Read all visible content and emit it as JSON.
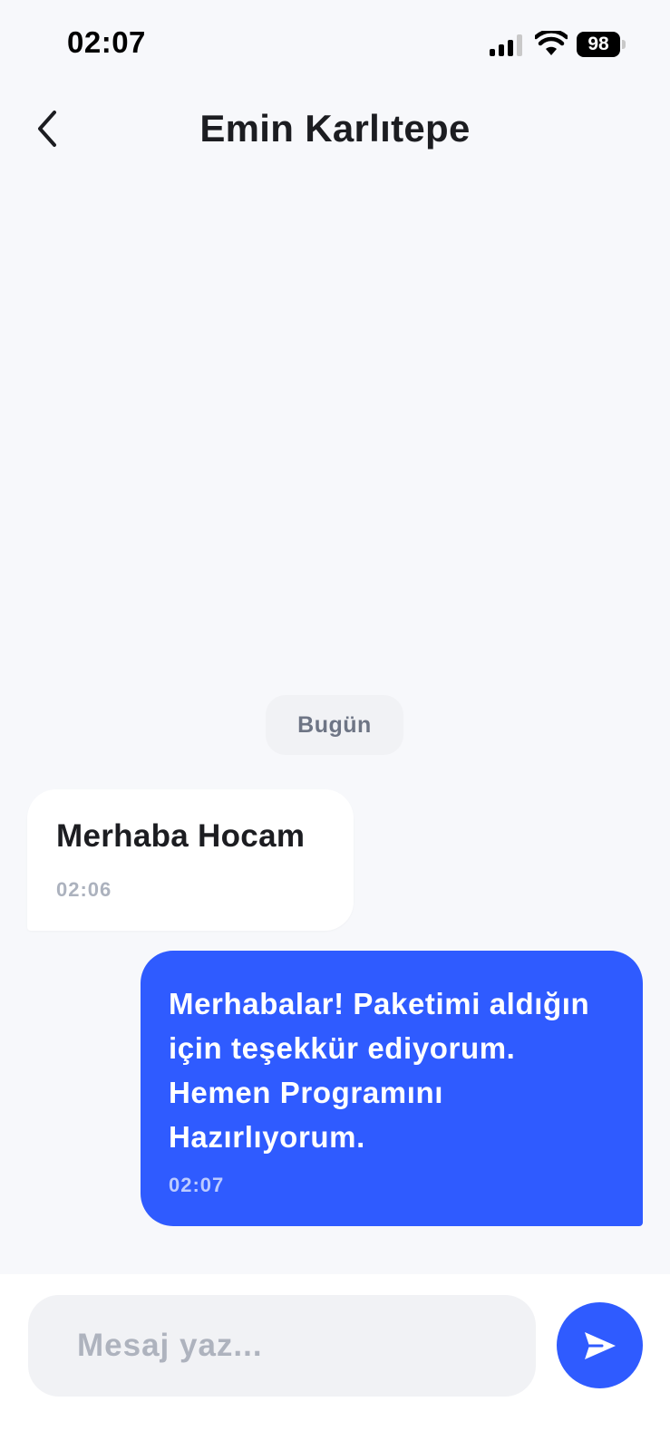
{
  "status_bar": {
    "time": "02:07",
    "battery": "98",
    "icons": [
      "signal-icon",
      "wifi-icon",
      "battery-icon"
    ]
  },
  "header": {
    "title": "Emin Karlıtepe",
    "back_icon": "chevron-left-icon"
  },
  "chat": {
    "date_separator": "Bugün",
    "messages": [
      {
        "direction": "incoming",
        "text": "Merhaba Hocam",
        "time": "02:06"
      },
      {
        "direction": "outgoing",
        "text": "Merhabalar! Paketimi aldığın için teşekkür ediyorum. Hemen Programını Hazırlıyorum.",
        "time": "02:07"
      }
    ]
  },
  "composer": {
    "placeholder": "Mesaj yaz...",
    "value": "",
    "send_icon": "send-icon"
  },
  "colors": {
    "accent": "#2F5BFF",
    "background": "#F7F8FB",
    "incoming_bubble": "#FFFFFF",
    "input_background": "#F1F2F5"
  }
}
